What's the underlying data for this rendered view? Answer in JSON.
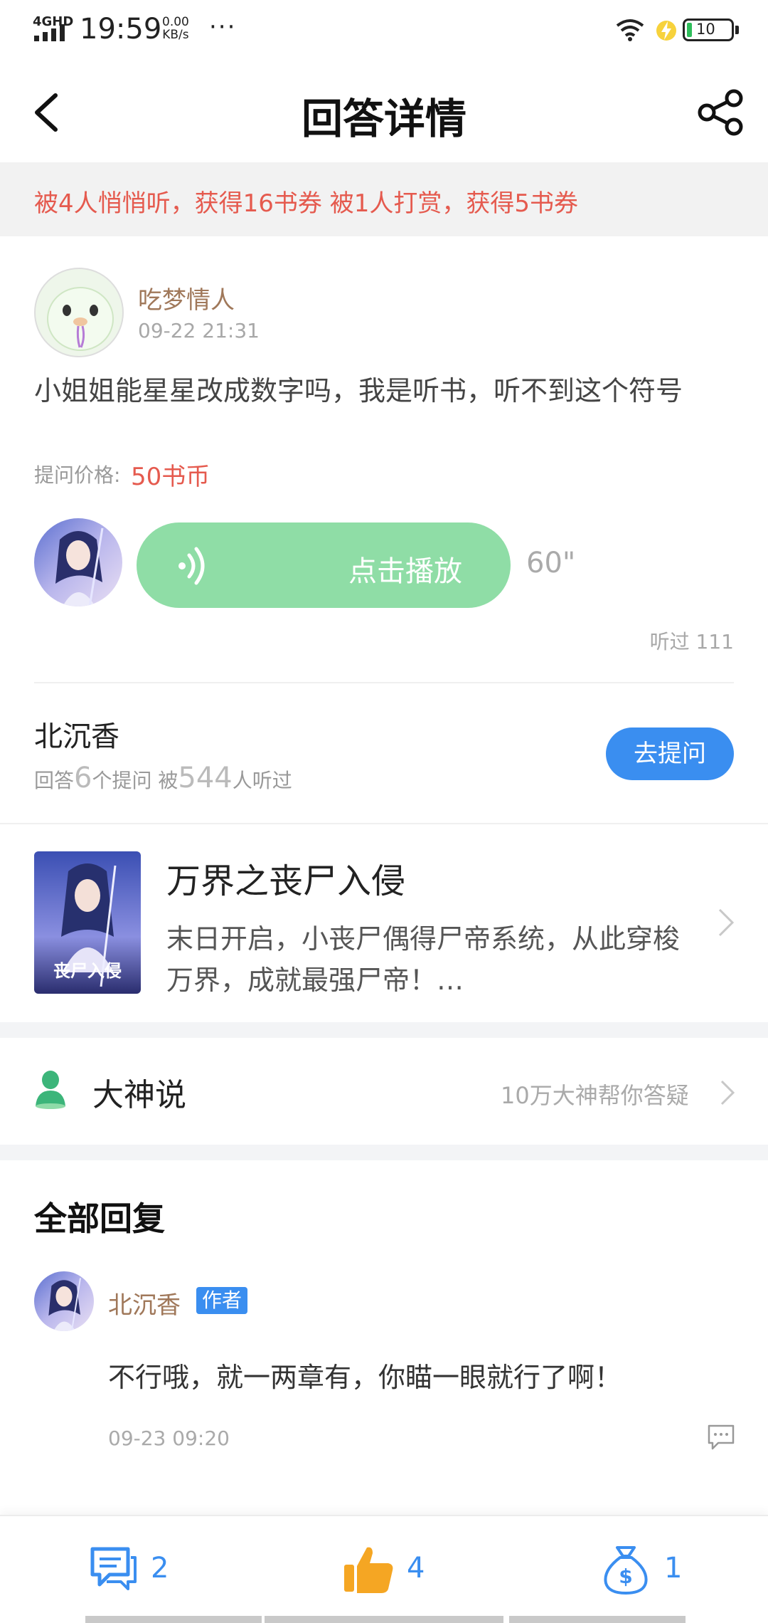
{
  "status_bar": {
    "network": "4GHD",
    "time": "19:59",
    "speed_value": "0.00",
    "speed_unit": "KB/s",
    "more": "···",
    "battery": "10"
  },
  "header": {
    "title": "回答详情"
  },
  "notice": {
    "text": "被4人悄悄听，获得16书券 被1人打赏，获得5书券"
  },
  "question": {
    "asker_name": "吃梦情人",
    "time": "09-22 21:31",
    "text": "小姐姐能星星改成数字吗，我是听书，听不到这个符号",
    "price_label": "提问价格:",
    "price_value": "50书币"
  },
  "audio": {
    "play_label": "点击播放",
    "duration": "60\"",
    "listened": "听过 111"
  },
  "answerer": {
    "name": "北沉香",
    "stats_prefix": "回答",
    "answer_count": "6",
    "stats_mid": "个提问  被",
    "listen_count": "544",
    "stats_suffix": "人听过",
    "ask_button": "去提问"
  },
  "book": {
    "title": "万界之丧尸入侵",
    "description": "末日开启，小丧尸偶得尸帝系统，从此穿梭万界，成就最强尸帝！…",
    "cover_text": "丧尸入侵"
  },
  "dashen": {
    "title": "大神说",
    "subtitle": "10万大神帮你答疑"
  },
  "replies": {
    "title": "全部回复",
    "items": [
      {
        "name": "北沉香",
        "badge": "作者",
        "text": "不行哦，就一两章有，你瞄一眼就行了啊！",
        "time": "09-23 09:20"
      }
    ]
  },
  "bottom_bar": {
    "comments": "2",
    "likes": "4",
    "rewards": "1"
  },
  "colors": {
    "accent_blue": "#3a8ef0",
    "notice_red": "#e55a4e",
    "audio_green": "#8fdda6",
    "name_brown": "#a0785a",
    "like_orange": "#f5a623"
  }
}
